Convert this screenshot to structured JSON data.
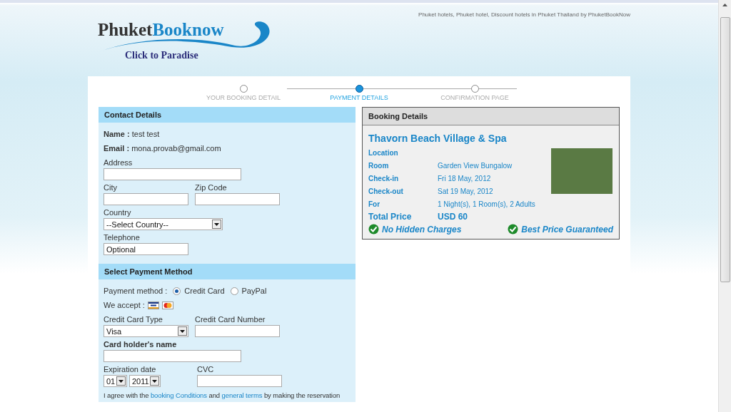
{
  "header": {
    "tagline": "Phuket hotels, Phuket hotel, Discount hotels in Phuket Thailand by PhuketBookNow",
    "logo": {
      "word_1": "Phuket",
      "word_2": "Booknow",
      "slogan": "Click to Paradise"
    }
  },
  "steps": [
    {
      "label": "YOUR BOOKING DETAIL",
      "selected": false
    },
    {
      "label": "PAYMENT DETAILS",
      "selected": true
    },
    {
      "label": "CONFIRMATION PAGE",
      "selected": false
    }
  ],
  "contact": {
    "title": "Contact Details",
    "name_label": "Name :",
    "name": "test test",
    "email_label": "Email :",
    "email": "mona.provab@gmail.com",
    "address": {
      "label": "Address"
    },
    "city": {
      "label": "City"
    },
    "zip": {
      "label": "Zip Code"
    },
    "country": {
      "label": "Country",
      "value": "--Select Country--"
    },
    "telephone": {
      "label": "Telephone",
      "placeholder": "Optional"
    }
  },
  "payment": {
    "title": "Select Payment Method",
    "method_label": "Payment method :",
    "methods": [
      {
        "label": "Credit Card",
        "selected": true
      },
      {
        "label": "PayPal",
        "selected": false
      }
    ],
    "accept_label": "We accept :",
    "card_type": {
      "label": "Credit Card Type",
      "value": "Visa"
    },
    "card_number": {
      "label": "Credit Card Number"
    },
    "holder": {
      "label": "Card holder's name"
    },
    "expiration": {
      "label": "Expiration date",
      "month": "01",
      "year": "2011"
    },
    "cvc": {
      "label": "CVC"
    },
    "agreement": {
      "before": "I agree with the",
      "link_1": "booking Conditions",
      "middle": "and",
      "link_2": "general terms",
      "after": "by making the reservation"
    }
  },
  "booking": {
    "title": "Booking Details",
    "hotel": "Thavorn Beach Village & Spa",
    "rows": [
      {
        "label": "Location"
      },
      {
        "label": "Room",
        "value": "Garden View Bungalow"
      },
      {
        "label": "Check-in",
        "value": "Fri 18 May, 2012"
      },
      {
        "label": "Check-out",
        "value": "Sat 19 May, 2012"
      },
      {
        "label": "For",
        "value": "1 Night(s), 1 Room(s), 2 Adults"
      }
    ],
    "total_label": "Total Price",
    "total_value": "USD 60",
    "guarantees": [
      "No Hidden Charges",
      "Best Price Guaranteed"
    ]
  }
}
